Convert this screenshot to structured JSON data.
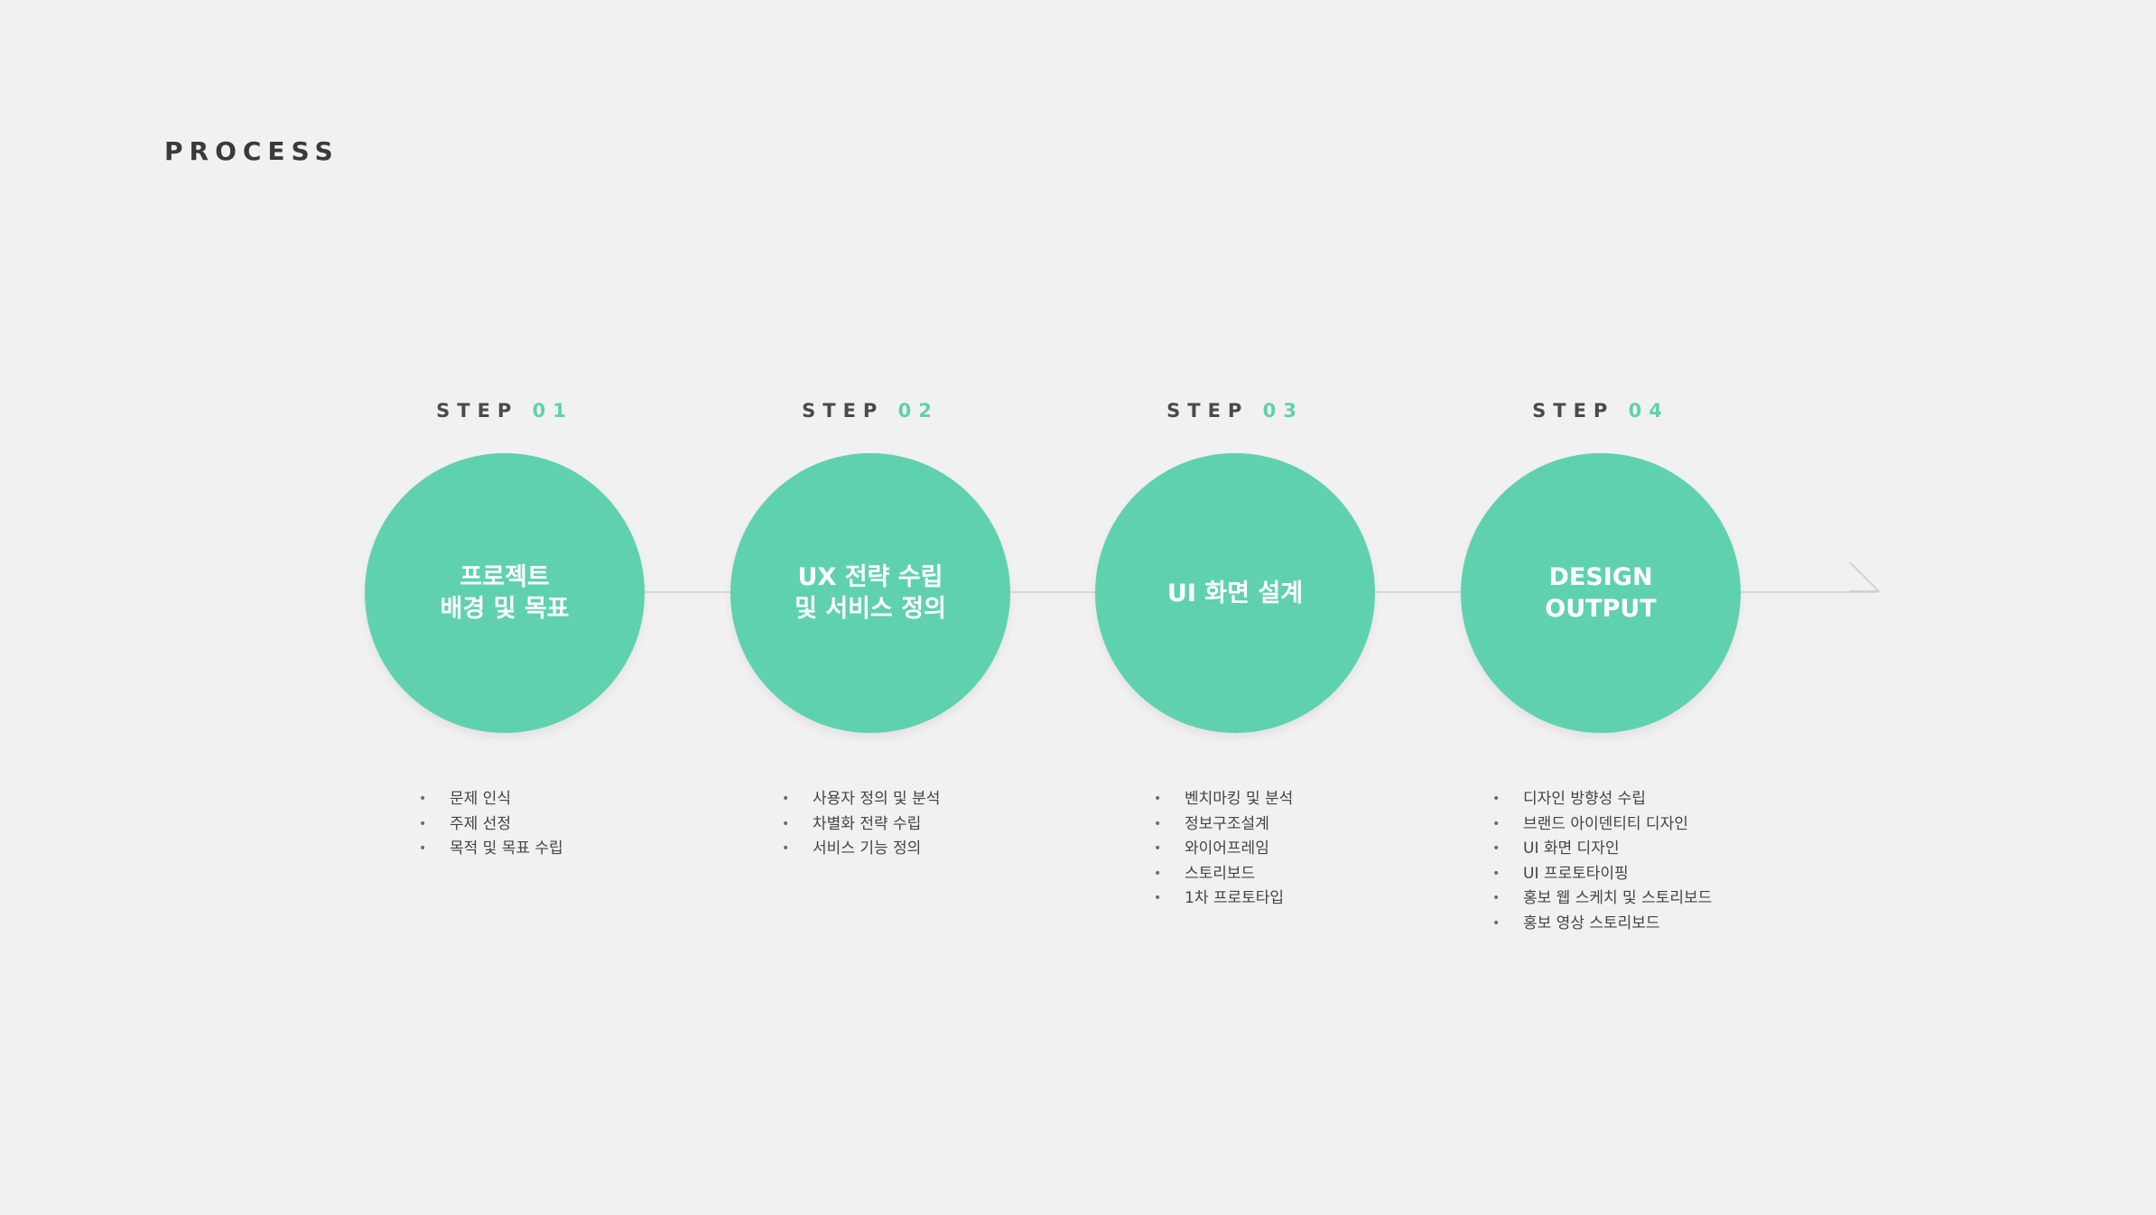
{
  "page": {
    "title": "PROCESS"
  },
  "colors": {
    "accent": "#60d1ae",
    "step_number": "#5fd1ad",
    "text": "#3a3a3a",
    "background": "#f1f1f1",
    "line": "#d9d9d9"
  },
  "steps": [
    {
      "label": "STEP",
      "number": "01",
      "circle_lines": [
        "프로젝트",
        "배경 및 목표"
      ],
      "items": [
        "문제 인식",
        "주제 선정",
        "목적 및 목표 수립"
      ]
    },
    {
      "label": "STEP",
      "number": "02",
      "circle_lines": [
        "UX 전략 수립",
        "및 서비스 정의"
      ],
      "items": [
        "사용자 정의 및 분석",
        "차별화 전략 수립",
        "서비스 기능 정의"
      ]
    },
    {
      "label": "STEP",
      "number": "03",
      "circle_lines": [
        "UI 화면 설계"
      ],
      "items": [
        "벤치마킹 및 분석",
        "정보구조설계",
        "와이어프레임",
        "스토리보드",
        "1차 프로토타입"
      ]
    },
    {
      "label": "STEP",
      "number": "04",
      "circle_lines": [
        "DESIGN",
        "OUTPUT"
      ],
      "items": [
        "디자인 방향성 수립",
        "브랜드 아이덴티티 디자인",
        "UI 화면 디자인",
        "UI 프로토타이핑",
        "홍보 웹 스케치 및 스토리보드",
        "홍보 영상 스토리보드"
      ]
    }
  ]
}
